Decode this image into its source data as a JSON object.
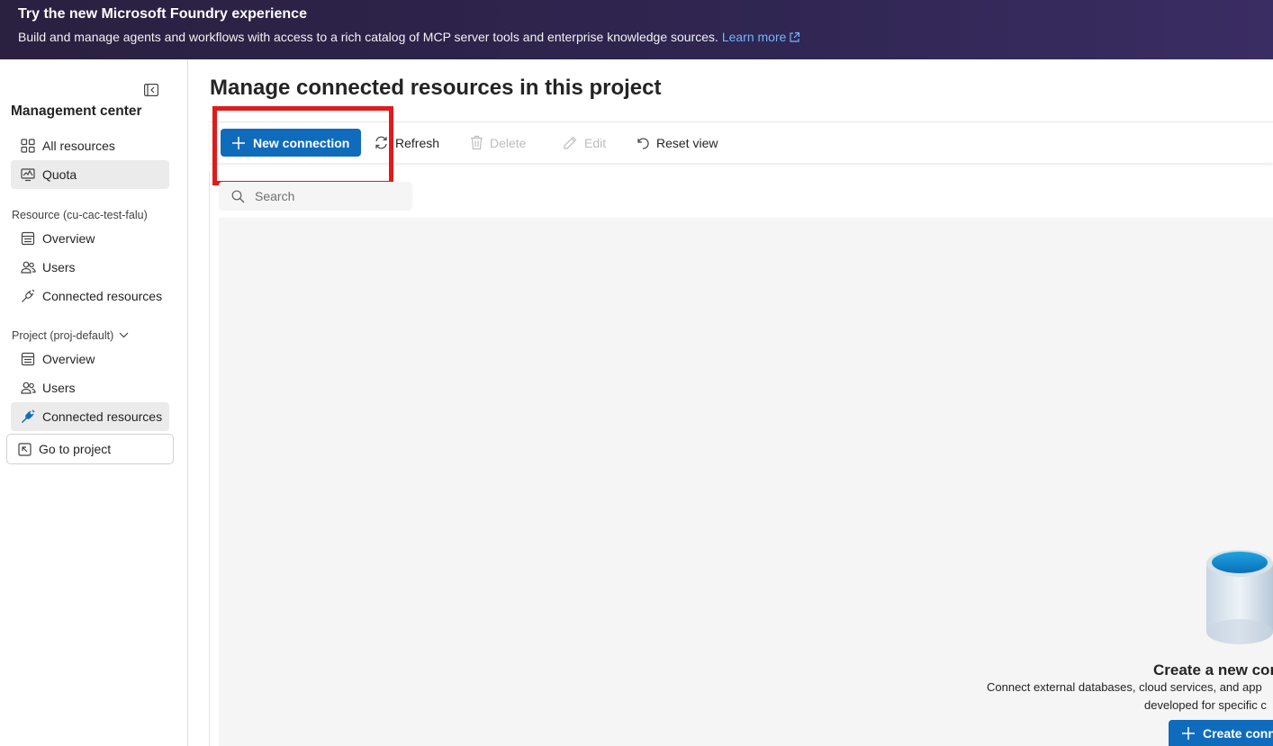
{
  "banner": {
    "title": "Try the new Microsoft Foundry experience",
    "description": "Build and manage agents and workflows with access to a rich catalog of MCP server tools and enterprise knowledge sources.",
    "link_label": "Learn more"
  },
  "sidebar": {
    "title": "Management center",
    "top_items": [
      {
        "label": "All resources",
        "icon": "grid-icon"
      },
      {
        "label": "Quota",
        "icon": "gauge-icon"
      }
    ],
    "resource_section": {
      "label": "Resource (cu-cac-test-falu)",
      "items": [
        {
          "label": "Overview",
          "icon": "overview-icon"
        },
        {
          "label": "Users",
          "icon": "people-icon"
        },
        {
          "label": "Connected resources",
          "icon": "plug-icon"
        }
      ]
    },
    "project_section": {
      "label": "Project (proj-default)",
      "items": [
        {
          "label": "Overview",
          "icon": "overview-icon"
        },
        {
          "label": "Users",
          "icon": "people-icon"
        },
        {
          "label": "Connected resources",
          "icon": "plug-icon"
        }
      ]
    },
    "goto_label": "Go to project"
  },
  "main": {
    "title": "Manage connected resources in this project",
    "toolbar": {
      "new_connection": "New connection",
      "refresh": "Refresh",
      "delete": "Delete",
      "edit": "Edit",
      "reset_view": "Reset view"
    },
    "search": {
      "placeholder": "Search",
      "value": ""
    },
    "empty_state": {
      "title": "Create a new cor",
      "line1": "Connect external databases, cloud services, and app",
      "line2": "developed for specific c",
      "button": "Create conn"
    }
  },
  "colors": {
    "accent": "#0f6cbd",
    "highlight": "#e01b1b",
    "banner": "#2f2550",
    "link": "#6fb5ff"
  }
}
